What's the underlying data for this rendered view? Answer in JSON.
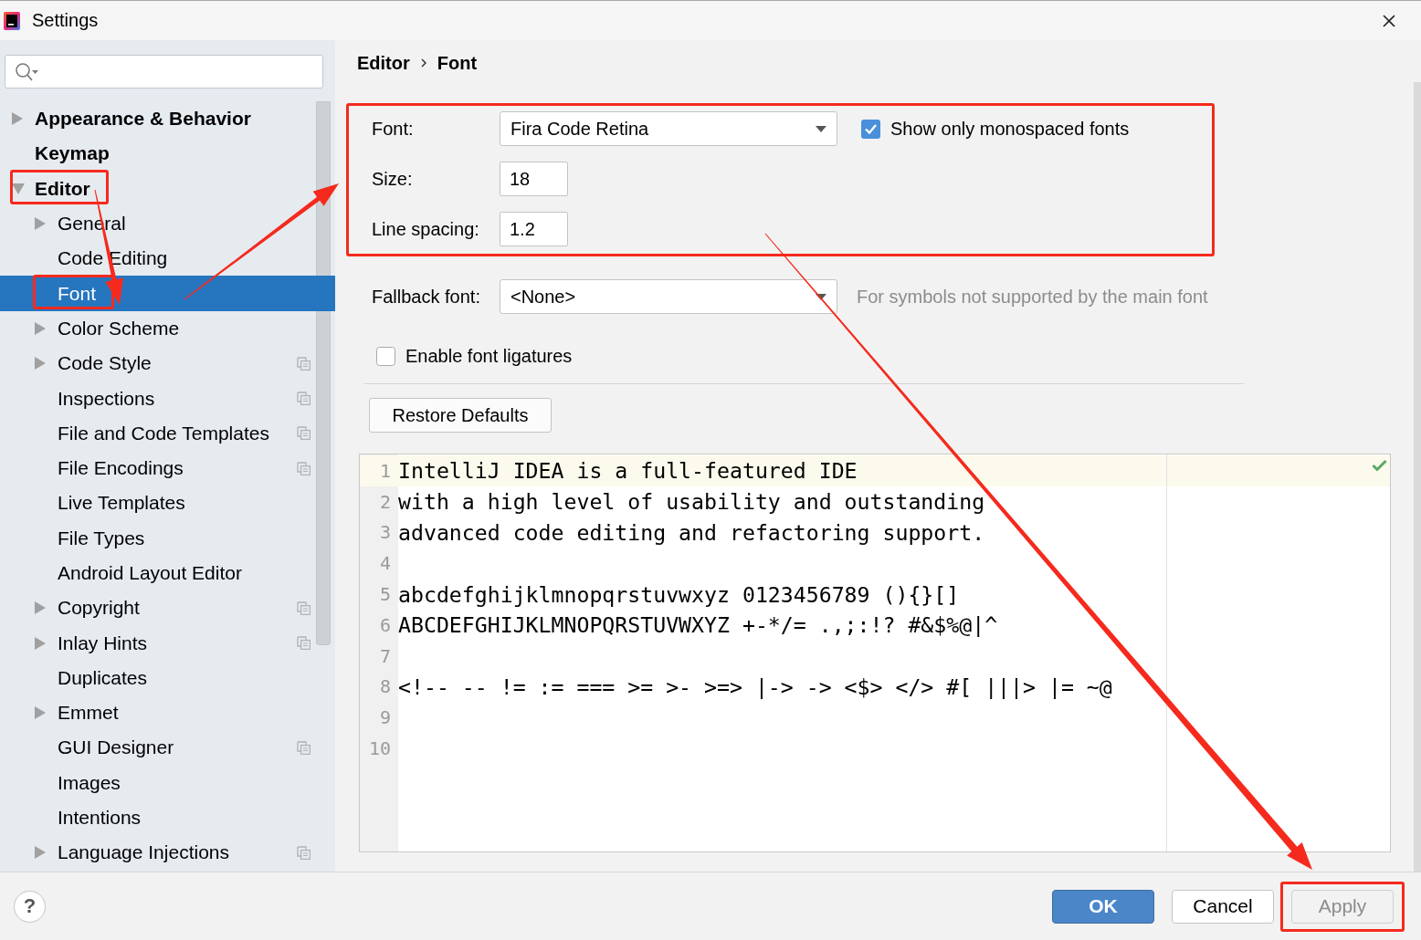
{
  "window": {
    "title": "Settings"
  },
  "sidebar": {
    "items": [
      {
        "label": "Appearance & Behavior",
        "expanded": false,
        "selected": false
      },
      {
        "label": "Keymap",
        "selected": false
      },
      {
        "label": "Editor",
        "expanded": true,
        "selected": false,
        "annotated": true,
        "children": [
          {
            "label": "General",
            "expanded": false,
            "selected": false
          },
          {
            "label": "Code Editing",
            "selected": false
          },
          {
            "label": "Font",
            "selected": true,
            "annotated": true
          },
          {
            "label": "Color Scheme",
            "expanded": false,
            "selected": false
          },
          {
            "label": "Code Style",
            "expanded": false,
            "selected": false,
            "project_scoped": true
          },
          {
            "label": "Inspections",
            "selected": false,
            "project_scoped": true
          },
          {
            "label": "File and Code Templates",
            "selected": false,
            "project_scoped": true
          },
          {
            "label": "File Encodings",
            "selected": false,
            "project_scoped": true
          },
          {
            "label": "Live Templates",
            "selected": false
          },
          {
            "label": "File Types",
            "selected": false
          },
          {
            "label": "Android Layout Editor",
            "selected": false
          },
          {
            "label": "Copyright",
            "expanded": false,
            "selected": false,
            "project_scoped": true
          },
          {
            "label": "Inlay Hints",
            "expanded": false,
            "selected": false,
            "project_scoped": true
          },
          {
            "label": "Duplicates",
            "selected": false
          },
          {
            "label": "Emmet",
            "expanded": false,
            "selected": false
          },
          {
            "label": "GUI Designer",
            "selected": false,
            "project_scoped": true
          },
          {
            "label": "Images",
            "selected": false
          },
          {
            "label": "Intentions",
            "selected": false
          },
          {
            "label": "Language Injections",
            "expanded": false,
            "selected": false,
            "project_scoped": true
          }
        ]
      }
    ]
  },
  "breadcrumb": [
    "Editor",
    "Font"
  ],
  "font_settings": {
    "annotated": true,
    "font": {
      "label": "Font:",
      "value": "Fira Code Retina"
    },
    "monospaced_only": {
      "label": "Show only monospaced fonts",
      "checked": true
    },
    "size": {
      "label": "Size:",
      "value": "18"
    },
    "line_spacing": {
      "label": "Line spacing:",
      "value": "1.2"
    }
  },
  "fallback_font": {
    "label": "Fallback font:",
    "value": "<None>",
    "hint": "For symbols not supported by the main font"
  },
  "ligatures": {
    "label": "Enable font ligatures",
    "checked": false
  },
  "restore_button": "Restore Defaults",
  "preview": {
    "lines": [
      {
        "number": "1",
        "text": "IntelliJ IDEA is a full-featured IDE",
        "current": true
      },
      {
        "number": "2",
        "text": "with a high level of usability and outstanding",
        "current": false
      },
      {
        "number": "3",
        "text": "advanced code editing and refactoring support.",
        "current": false
      },
      {
        "number": "4",
        "current": false
      },
      {
        "number": "5",
        "text": "abcdefghijklmnopqrstuvwxyz 0123456789 (){}[]",
        "current": false
      },
      {
        "number": "6",
        "text": "ABCDEFGHIJKLMNOPQRSTUVWXYZ +-*/= .,;:!? #&$%@|^",
        "current": false
      },
      {
        "number": "7",
        "current": false
      },
      {
        "number": "8",
        "text": "<!-- -- != := === >= >- >=> |-> -> <$> </> #[ |||> |= ~@",
        "current": false
      },
      {
        "number": "9",
        "current": false
      },
      {
        "number": "10",
        "current": false
      }
    ]
  },
  "help_button": "?",
  "buttons": [
    {
      "label": "OK",
      "kind": "default",
      "disabled": false
    },
    {
      "label": "Cancel",
      "kind": "normal",
      "disabled": false
    },
    {
      "label": "Apply",
      "kind": "normal",
      "disabled": true,
      "annotated": true
    }
  ]
}
